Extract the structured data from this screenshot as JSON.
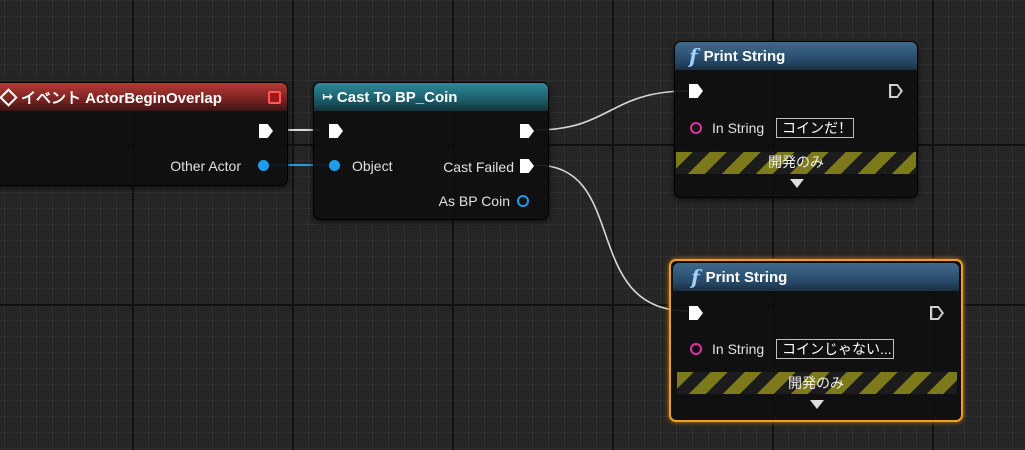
{
  "event_node": {
    "title": "イベント ActorBeginOverlap",
    "header_color": "#b83a36",
    "icon": "diamond-icon",
    "output_pins": [
      "Other Actor"
    ]
  },
  "cast_node": {
    "title": "Cast To BP_Coin",
    "header_color": "#2e8a9a",
    "icon": "cast-arrow-icon",
    "input_pins": [
      "Object"
    ],
    "output_pins": [
      "Cast Failed",
      "As BP Coin"
    ]
  },
  "print_nodes": [
    {
      "title": "Print String",
      "icon": "function-icon",
      "in_string_label": "In String",
      "in_string_value": "コインだ！",
      "dev_only_label": "開発のみ",
      "selected": false
    },
    {
      "title": "Print String",
      "icon": "function-icon",
      "in_string_label": "In String",
      "in_string_value": "コインじゃない...",
      "dev_only_label": "開発のみ",
      "selected": true
    }
  ],
  "colors": {
    "exec_wire": "#ffffff",
    "object_pin": "#1f9bea",
    "string_pin": "#e0309e",
    "selection": "#f0a020",
    "dev_stripe": "#7d7a1c"
  }
}
